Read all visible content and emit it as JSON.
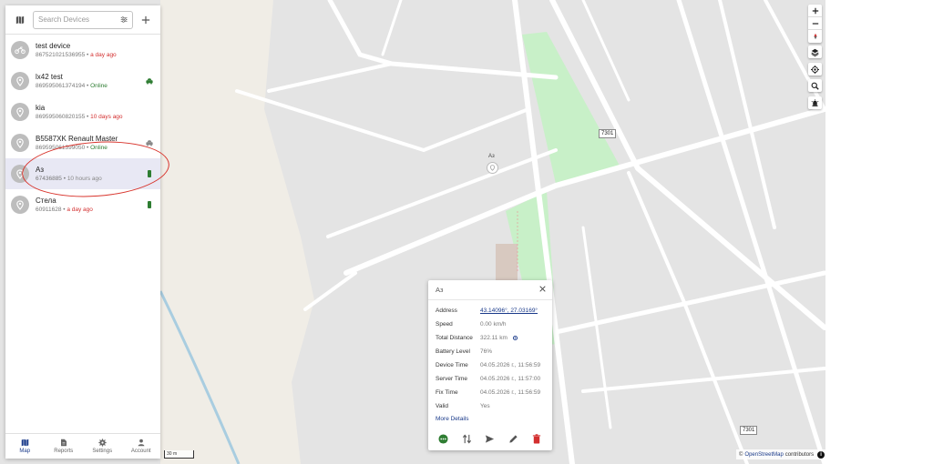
{
  "search": {
    "placeholder": "Search Devices"
  },
  "devices": [
    {
      "name": "test device",
      "id": "867521021536955",
      "status": "a day ago",
      "status_type": "offline",
      "icon": "motorcycle-icon"
    },
    {
      "name": "lx42 test",
      "id": "869595061374194",
      "status": "Online",
      "status_type": "online",
      "icon": "pin-icon"
    },
    {
      "name": "kia",
      "id": "869595060820155",
      "status": "10 days ago",
      "status_type": "offline",
      "icon": "pin-icon"
    },
    {
      "name": "B5587XK Renault Master",
      "id": "869595061399050",
      "status": "Online",
      "status_type": "online",
      "icon": "pin-icon"
    },
    {
      "name": "Аз",
      "id": "67436885",
      "status": "10 hours ago",
      "status_type": "unknown",
      "icon": "pin-icon"
    },
    {
      "name": "Стела",
      "id": "60911628",
      "status": "a day ago",
      "status_type": "offline",
      "icon": "pin-icon"
    }
  ],
  "nav": [
    {
      "label": "Map",
      "icon": "map-icon"
    },
    {
      "label": "Reports",
      "icon": "reports-icon"
    },
    {
      "label": "Settings",
      "icon": "settings-icon"
    },
    {
      "label": "Account",
      "icon": "account-icon"
    }
  ],
  "popup": {
    "title": "Аз",
    "rows": [
      {
        "label": "Address",
        "value": "43.14096°, 27.03169°"
      },
      {
        "label": "Speed",
        "value": "0.00 km/h"
      },
      {
        "label": "Total Distance",
        "value": "322.11 km"
      },
      {
        "label": "Battery Level",
        "value": "76%"
      },
      {
        "label": "Device Time",
        "value": "04.05.2026 г., 11:56:59"
      },
      {
        "label": "Server Time",
        "value": "04.05.2026 г., 11:57:00"
      },
      {
        "label": "Fix Time",
        "value": "04.05.2026 г., 11:56:59"
      },
      {
        "label": "Valid",
        "value": "Yes"
      }
    ],
    "more_details": "More Details"
  },
  "map": {
    "marker_label": "Аз",
    "road_label_1": "7301",
    "road_label_2": "7301",
    "scale_label": "30 m",
    "attribution_prefix": "©",
    "attribution_link": "OpenStreetMap",
    "attribution_suffix": "contributors",
    "info_glyph": "i"
  },
  "colors": {
    "online": "#2e7d32",
    "offline": "#d32f2f",
    "accent": "#1a3a8a",
    "park": "#c8f0c8",
    "delete": "#d32f2f"
  }
}
